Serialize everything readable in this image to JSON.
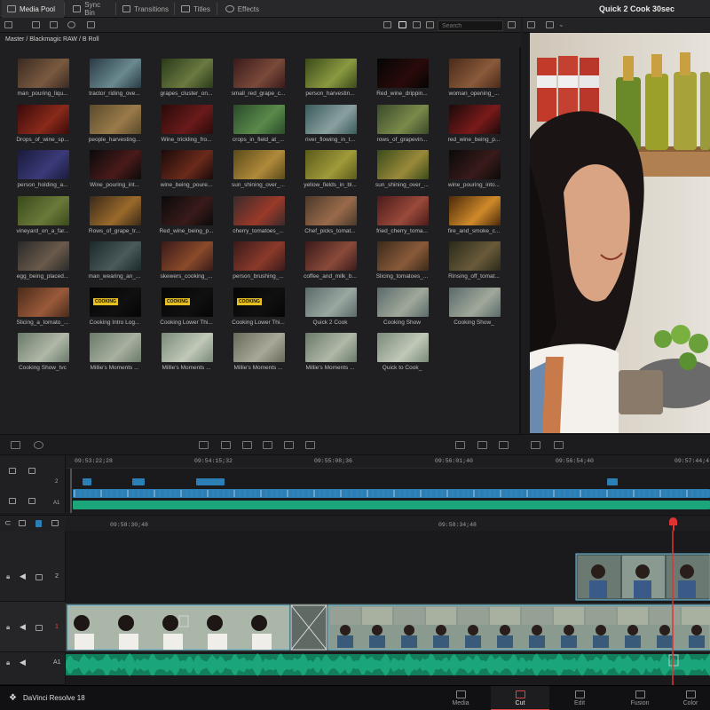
{
  "topbar": {
    "tabs": [
      {
        "label": "Media Pool",
        "icon": "media-pool-icon",
        "active": true
      },
      {
        "label": "Sync Bin",
        "icon": "sync-bin-icon",
        "active": false
      },
      {
        "label": "Transitions",
        "icon": "transitions-icon",
        "active": false
      },
      {
        "label": "Titles",
        "icon": "titles-icon",
        "active": false
      },
      {
        "label": "Effects",
        "icon": "effects-icon",
        "active": false
      }
    ],
    "project_title": "Quick 2 Cook 30sec"
  },
  "search": {
    "placeholder": "Search"
  },
  "breadcrumb": "Master / Blackmagic RAW / B Roll",
  "clips": [
    {
      "label": "man_pouring_liqu...",
      "c1": "#3a2a22",
      "c2": "#7a5a40"
    },
    {
      "label": "tractor_riding_ove...",
      "c1": "#2a3a44",
      "c2": "#6a8a90"
    },
    {
      "label": "grapes_cluster_on...",
      "c1": "#2a3a1a",
      "c2": "#6a7a40"
    },
    {
      "label": "small_red_grape_c...",
      "c1": "#3a1a1a",
      "c2": "#7a4a3a"
    },
    {
      "label": "person_harvestin...",
      "c1": "#3a4a1a",
      "c2": "#8a9a40"
    },
    {
      "label": "Red_wine_drippin...",
      "c1": "#050505",
      "c2": "#2a0a0a"
    },
    {
      "label": "woman_opening_...",
      "c1": "#4a2a1a",
      "c2": "#8a5a3a"
    },
    {
      "label": "Drops_of_wine_sp...",
      "c1": "#3a0a0a",
      "c2": "#8a2a1a"
    },
    {
      "label": "people_harvesting...",
      "c1": "#5a4a2a",
      "c2": "#9a7a4a"
    },
    {
      "label": "Wine_trickling_fro...",
      "c1": "#2a0a0a",
      "c2": "#6a1a1a"
    },
    {
      "label": "crops_in_field_at_...",
      "c1": "#2a4a2a",
      "c2": "#5a8a4a"
    },
    {
      "label": "river_flowing_in_t...",
      "c1": "#3a5a5a",
      "c2": "#8aa0a0"
    },
    {
      "label": "rows_of_grapevin...",
      "c1": "#3a4a2a",
      "c2": "#7a8a4a"
    },
    {
      "label": "red_wine_being_p...",
      "c1": "#1a0a0a",
      "c2": "#7a1a1a"
    },
    {
      "label": "person_holding_a...",
      "c1": "#1a1a3a",
      "c2": "#3a3a7a"
    },
    {
      "label": "Wine_pouring_int...",
      "c1": "#0a0a0a",
      "c2": "#4a1a1a"
    },
    {
      "label": "wine_being_poure...",
      "c1": "#1a0a0a",
      "c2": "#6a2a1a"
    },
    {
      "label": "sun_shining_over_...",
      "c1": "#5a4a1a",
      "c2": "#b08a3a"
    },
    {
      "label": "yellow_fields_in_bl...",
      "c1": "#5a5a1a",
      "c2": "#a09a3a"
    },
    {
      "label": "sun_shining_over_...",
      "c1": "#3a4a1a",
      "c2": "#9a8a3a"
    },
    {
      "label": "wine_pouring_into...",
      "c1": "#0a0a0a",
      "c2": "#3a1a1a"
    },
    {
      "label": "vineyard_on_a_far...",
      "c1": "#3a4a1a",
      "c2": "#6a7a3a"
    },
    {
      "label": "Rows_of_grape_tr...",
      "c1": "#3a2a1a",
      "c2": "#9a6a2a"
    },
    {
      "label": "Red_wine_being_p...",
      "c1": "#0a0a0a",
      "c2": "#3a1a1a"
    },
    {
      "label": "cherry_tomatoes_...",
      "c1": "#3a2a2a",
      "c2": "#9a3a2a"
    },
    {
      "label": "Chef_picks_tomat...",
      "c1": "#4a3a2a",
      "c2": "#9a6a4a"
    },
    {
      "label": "fried_cherry_toma...",
      "c1": "#4a1a1a",
      "c2": "#9a4a3a"
    },
    {
      "label": "fire_and_smoke_c...",
      "c1": "#4a2a0a",
      "c2": "#d08a2a"
    },
    {
      "label": "egg_being_placed...",
      "c1": "#2a2a2a",
      "c2": "#6a5a4a"
    },
    {
      "label": "man_wearing_an_...",
      "c1": "#1a2a2a",
      "c2": "#4a5a5a"
    },
    {
      "label": "skewers_cooking_...",
      "c1": "#3a1a1a",
      "c2": "#8a4a2a"
    },
    {
      "label": "person_brushing_...",
      "c1": "#3a1a1a",
      "c2": "#8a3a2a"
    },
    {
      "label": "coffee_and_milk_b...",
      "c1": "#3a1a1a",
      "c2": "#8a4a3a"
    },
    {
      "label": "Slicing_tomatoes_...",
      "c1": "#3a2a1a",
      "c2": "#8a5a3a"
    },
    {
      "label": "Rinsing_off_tomat...",
      "c1": "#2a2a1a",
      "c2": "#6a5a3a"
    },
    {
      "label": "Slicing_a_tomato_...",
      "c1": "#4a2a1a",
      "c2": "#9a5a3a"
    },
    {
      "label": "Cooking Intro Log...",
      "c1": "#050505",
      "c2": "#101010"
    },
    {
      "label": "Cooking Lower Thi...",
      "c1": "#050505",
      "c2": "#101010"
    },
    {
      "label": "Cooking Lower Thi...",
      "c1": "#050505",
      "c2": "#101010"
    },
    {
      "label": "Quick 2 Cook",
      "c1": "#5a6a6a",
      "c2": "#9aa8a0"
    },
    {
      "label": "Cooking Show",
      "c1": "#5a6a6a",
      "c2": "#a0a89a"
    },
    {
      "label": "Cooking Show_",
      "c1": "#5a6a6a",
      "c2": "#a0a89a"
    },
    {
      "label": "Cooking Show_tvc",
      "c1": "#6a7a6a",
      "c2": "#b0b8a8"
    },
    {
      "label": "Millie's Moments ...",
      "c1": "#6a7a6a",
      "c2": "#a8b0a0"
    },
    {
      "label": "Millie's Moments ...",
      "c1": "#7a8a7a",
      "c2": "#c0c8b8"
    },
    {
      "label": "Millie's Moments ...",
      "c1": "#6a6a5a",
      "c2": "#a8a898"
    },
    {
      "label": "Millie's Moments ...",
      "c1": "#6a7a6a",
      "c2": "#b0b8a8"
    },
    {
      "label": "Quick to Cook_",
      "c1": "#7a8a7a",
      "c2": "#c0c8b8"
    }
  ],
  "title_clips_text": "COOKING",
  "upper_timeline": {
    "timecodes": [
      "09:53:22;28",
      "09:54:15;32",
      "09:55:08;36",
      "09:56:01;40",
      "09:56:54;40",
      "09:57:44;4"
    ],
    "track_labels": [
      "2",
      "A1"
    ]
  },
  "lower_timeline": {
    "timecodes": [
      "09:58:30;48",
      "09:58:34;48"
    ],
    "tracks": [
      {
        "number": "2"
      },
      {
        "number": "1"
      },
      {
        "number": "A1"
      }
    ]
  },
  "colors": {
    "accent": "#e04545",
    "clip_blue": "#2b7fb4",
    "audio_green": "#1aa57a",
    "playhead": "#e03434"
  },
  "bottombar": {
    "brand": "DaVinci Resolve 18",
    "pages": [
      {
        "label": "Media",
        "active": false
      },
      {
        "label": "Cut",
        "active": true
      },
      {
        "label": "Edit",
        "active": false
      },
      {
        "label": "Fusion",
        "active": false
      },
      {
        "label": "Color",
        "active": false
      }
    ]
  }
}
